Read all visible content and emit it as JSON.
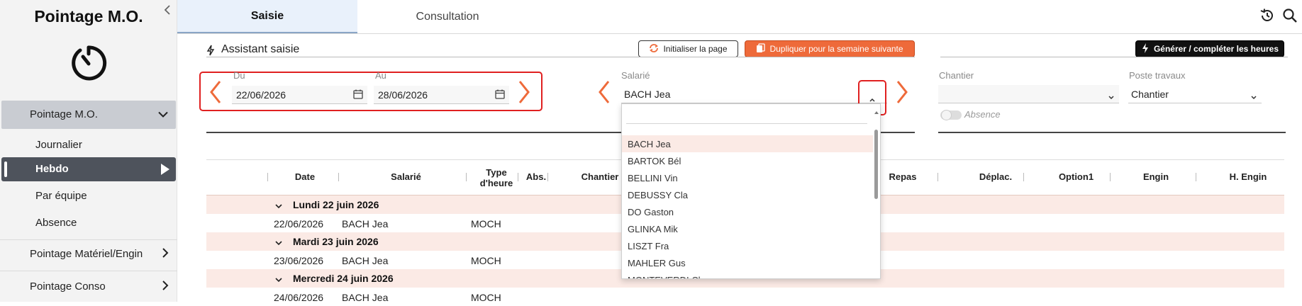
{
  "sidebar": {
    "title": "Pointage M.O.",
    "items": [
      {
        "label": "Pointage M.O."
      },
      {
        "label": "Journalier"
      },
      {
        "label": "Hebdo"
      },
      {
        "label": "Par équipe"
      },
      {
        "label": "Absence"
      },
      {
        "label": "Pointage Matériel/Engin"
      },
      {
        "label": "Pointage Conso"
      }
    ]
  },
  "tabs": [
    {
      "label": "Saisie"
    },
    {
      "label": "Consultation"
    }
  ],
  "assistant": {
    "title": "Assistant saisie",
    "init_label": "Initialiser la page",
    "dup_label": "Dupliquer pour la semaine suivante",
    "gen_label": "Générer / compléter les heures"
  },
  "filters": {
    "du_label": "Du",
    "du_value": "22/06/2026",
    "au_label": "Au",
    "au_value": "28/06/2026",
    "salarie_label": "Salarié",
    "salarie_value": "BACH Jea",
    "chantier_label": "Chantier",
    "chantier_value": "",
    "poste_label": "Poste travaux",
    "poste_value": "Chantier",
    "absence_label": "Absence"
  },
  "dropdown": {
    "search_value": "",
    "options": [
      "BACH Jea",
      "BARTOK Bél",
      "BELLINI Vin",
      "DEBUSSY Cla",
      "DO Gaston",
      "GLINKA Mik",
      "LISZT Fra",
      "MAHLER Gus",
      "MONTEVERDI Cl"
    ]
  },
  "table": {
    "headers": {
      "date": "Date",
      "salarie": "Salarié",
      "type1": "Type",
      "type2": "d'heure",
      "abs": "Abs.",
      "chantier": "Chantier",
      "repas": "Repas",
      "deplac": "Déplac.",
      "option1": "Option1",
      "engin": "Engin",
      "hengin": "H. Engin"
    },
    "groups": [
      {
        "label": "Lundi 22 juin 2026",
        "row": {
          "date": "22/06/2026",
          "salarie": "BACH Jea",
          "type": "MOCH"
        }
      },
      {
        "label": "Mardi 23 juin 2026",
        "row": {
          "date": "23/06/2026",
          "salarie": "BACH Jea",
          "type": "MOCH"
        }
      },
      {
        "label": "Mercredi 24 juin 2026",
        "row": {
          "date": "24/06/2026",
          "salarie": "BACH Jea",
          "type": "MOCH"
        }
      }
    ]
  }
}
